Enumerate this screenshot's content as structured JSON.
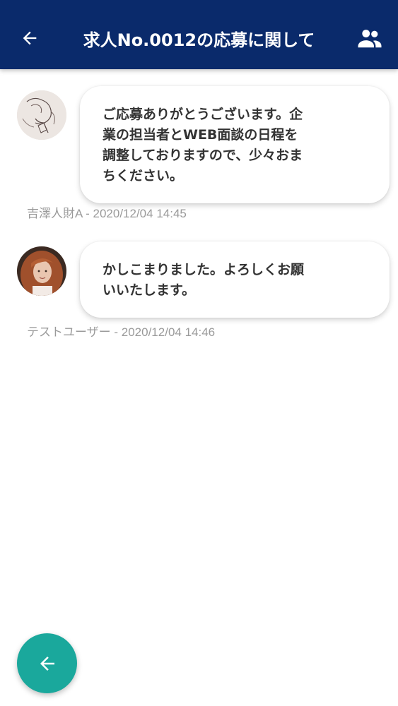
{
  "header": {
    "title": "求人No.0012の応募に関して",
    "back_icon": "arrow-left-icon",
    "participants_icon": "people-icon"
  },
  "messages": [
    {
      "text": "ご応募ありがとうございます。企\n業の担当者とWEB面談の日程を\n調整しておりますので、少々おま\nちください。",
      "meta": "吉澤人財A - 2020/12/04 14:45"
    },
    {
      "text": "かしこまりました。よろしくお願\nいいたします。",
      "meta": "テストユーザー - 2020/12/04 14:46"
    }
  ],
  "fab": {
    "icon": "arrow-left-icon"
  },
  "colors": {
    "app_bar": "#0a2a6b",
    "fab": "#1aa89c",
    "meta_text": "#9a9a9a"
  }
}
